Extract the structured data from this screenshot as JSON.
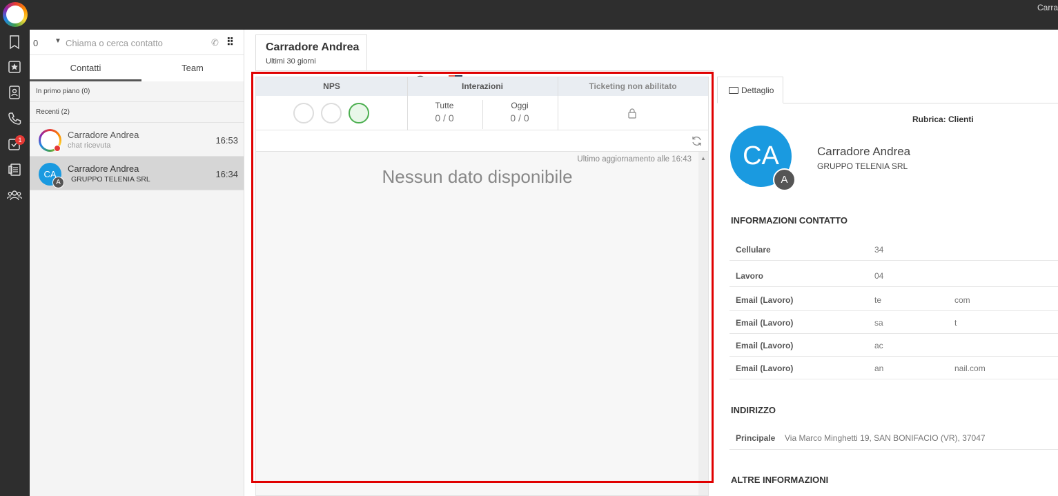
{
  "topbar": {
    "user_fragment": "Carrado"
  },
  "sidebar": {
    "badge_count": "1"
  },
  "contacts": {
    "dial_value": "0",
    "search_placeholder": "Chiama o cerca contatto",
    "tabs": [
      "Contatti",
      "Team"
    ],
    "featured_label": "In primo piano (0)",
    "recent_label": "Recenti (2)",
    "items": [
      {
        "name": "Carradore Andrea",
        "sub": "chat ricevuta",
        "time": "16:53"
      },
      {
        "name": "Carradore Andrea",
        "sub": "GRUPPO TELENIA SRL",
        "time": "16:34",
        "initials": "CA",
        "badge": "A"
      }
    ]
  },
  "main": {
    "tab_name": "Carradore Andrea",
    "tab_sub": "Ultimi 30 giorni",
    "nps_label": "NPS",
    "interactions_label": "Interazioni",
    "ticketing_label": "Ticketing non abilitato",
    "all_label": "Tutte",
    "all_value": "0 / 0",
    "today_label": "Oggi",
    "today_value": "0 / 0",
    "updated": "Ultimo aggiornamento alle 16:43",
    "no_data": "Nessun dato disponibile"
  },
  "detail": {
    "tab_label": "Dettaglio",
    "rubrica": "Rubrica: Clienti",
    "initials": "CA",
    "badge": "A",
    "name": "Carradore Andrea",
    "company": "GRUPPO TELENIA SRL",
    "info_title": "INFORMAZIONI CONTATTO",
    "rows": [
      {
        "k": "Cellulare",
        "v": "34",
        "v2": ""
      },
      {
        "k": "Lavoro",
        "v": "04",
        "v2": ""
      },
      {
        "k": "Email (Lavoro)",
        "v": "te",
        "v2": "com"
      },
      {
        "k": "Email (Lavoro)",
        "v": "sa",
        "v2": "t"
      },
      {
        "k": "Email (Lavoro)",
        "v": "ac",
        "v2": ""
      },
      {
        "k": "Email (Lavoro)",
        "v": "an",
        "v2": "nail.com"
      }
    ],
    "address_title": "INDIRIZZO",
    "address_key": "Principale",
    "address_value": "Via Marco Minghetti 19, SAN BONIFACIO (VR), 37047",
    "other_title": "ALTRE INFORMAZIONI"
  },
  "colors": {
    "accent": "#1a9ae0",
    "highlight": "#e00000",
    "nps_good": "#4caf50"
  }
}
